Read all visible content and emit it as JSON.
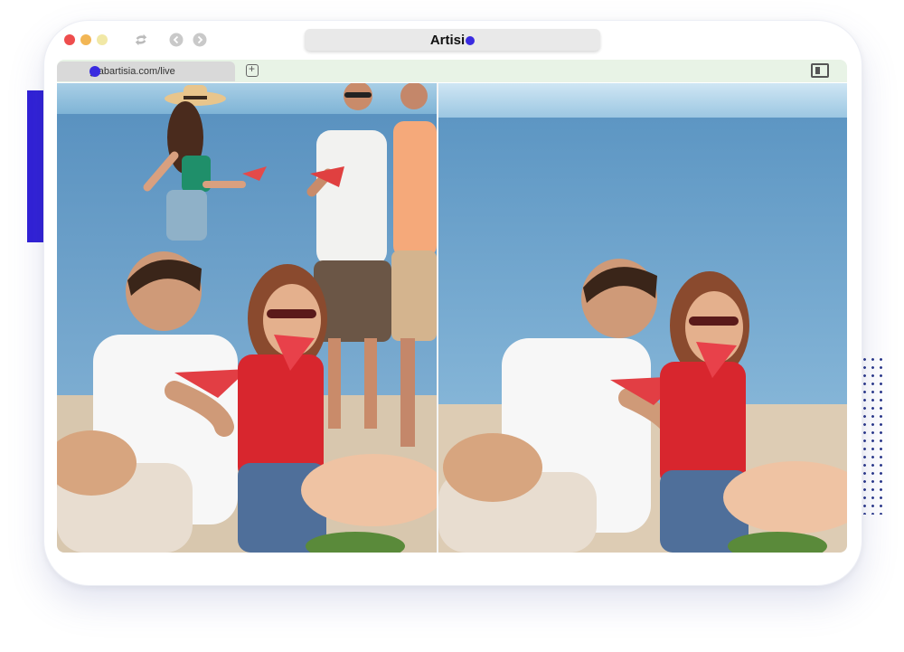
{
  "window": {
    "title_text": "Artisi",
    "url": "grabartisia.com/live"
  },
  "icons": {
    "traffic_lights": [
      "close-dot",
      "minimize-dot",
      "zoom-dot"
    ],
    "nav": [
      "refresh-icon",
      "back-icon",
      "forward-icon"
    ],
    "tab": "artisia-logo-icon",
    "new_tab": "new-tab-icon",
    "sidebar": "sidebar-toggle-icon"
  },
  "colors": {
    "accent": "#2f1fd6",
    "brand": "#3a2be0",
    "tabstrip": "#e8f3e6"
  },
  "content": {
    "panes": [
      "original-photo",
      "background-removed-photo"
    ]
  }
}
